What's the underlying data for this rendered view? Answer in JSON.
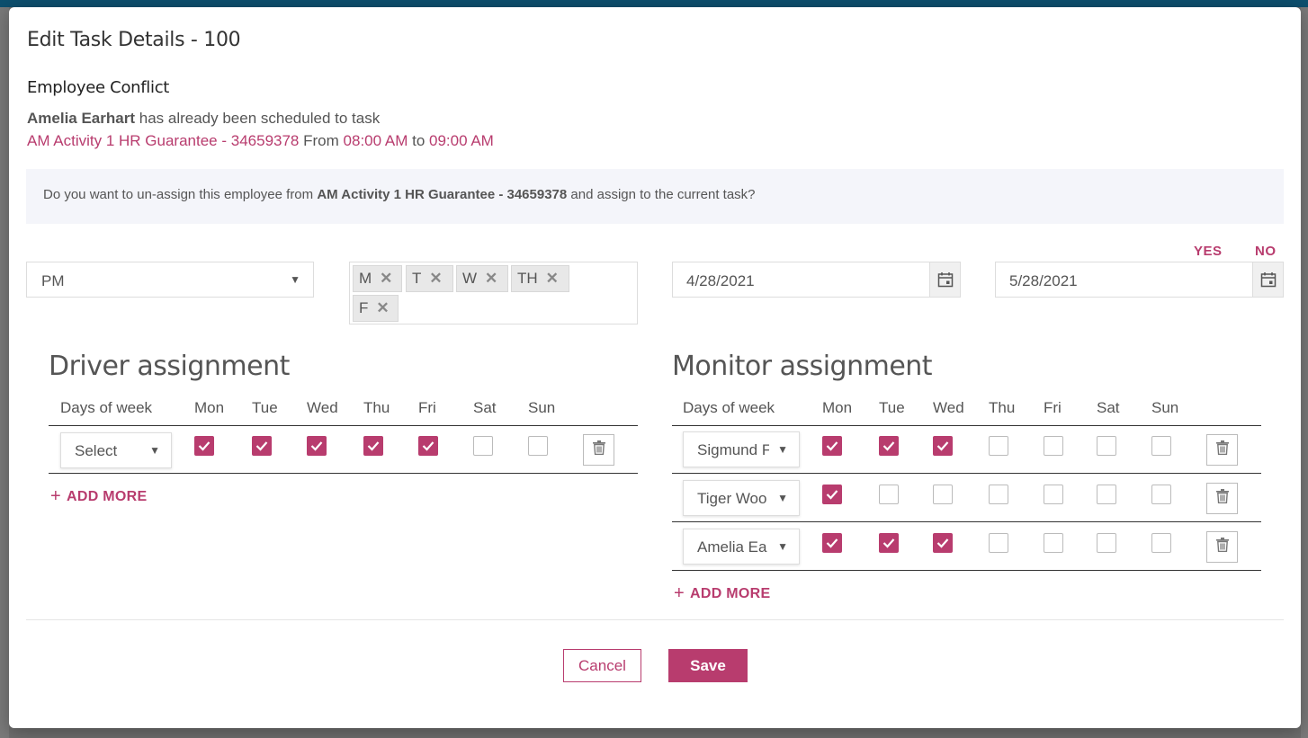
{
  "modal": {
    "title": "Edit Task Details - 100"
  },
  "conflict": {
    "heading": "Employee Conflict",
    "employee_name": "Amelia Earhart",
    "scheduled_text": "has already been scheduled to task",
    "task_name": "AM Activity 1 HR Guarantee - 34659378",
    "from_label": "From",
    "from_time": "08:00 AM",
    "to_label": "to",
    "to_time": "09:00 AM"
  },
  "banner": {
    "prefix": "Do you want to un-assign this employee from",
    "task_name": "AM Activity 1 HR Guarantee - 34659378",
    "suffix": "and assign to the current task?"
  },
  "actions": {
    "yes": "YES",
    "no": "NO"
  },
  "filters": {
    "period_value": "PM",
    "days_chips": [
      "M",
      "T",
      "W",
      "TH",
      "F"
    ],
    "start_date": "4/28/2021",
    "end_date": "5/28/2021"
  },
  "driver": {
    "title": "Driver assignment",
    "headers": [
      "Days of week",
      "Mon",
      "Tue",
      "Wed",
      "Thu",
      "Fri",
      "Sat",
      "Sun"
    ],
    "rows": [
      {
        "employee": "Select",
        "days": [
          true,
          true,
          true,
          true,
          true,
          false,
          false
        ]
      }
    ],
    "add_more": "ADD MORE"
  },
  "monitor": {
    "title": "Monitor assignment",
    "headers": [
      "Days of week",
      "Mon",
      "Tue",
      "Wed",
      "Thu",
      "Fri",
      "Sat",
      "Sun"
    ],
    "rows": [
      {
        "employee": "Sigmund F",
        "days": [
          true,
          true,
          true,
          false,
          false,
          false,
          false
        ]
      },
      {
        "employee": "Tiger Woo",
        "days": [
          true,
          false,
          false,
          false,
          false,
          false,
          false
        ]
      },
      {
        "employee": "Amelia Ea",
        "days": [
          true,
          true,
          true,
          false,
          false,
          false,
          false
        ]
      }
    ],
    "add_more": "ADD MORE"
  },
  "footer": {
    "cancel": "Cancel",
    "save": "Save"
  },
  "colors": {
    "accent": "#b83c6e",
    "banner_bg": "#f4f5fa",
    "topbar": "#0d4f6e"
  }
}
